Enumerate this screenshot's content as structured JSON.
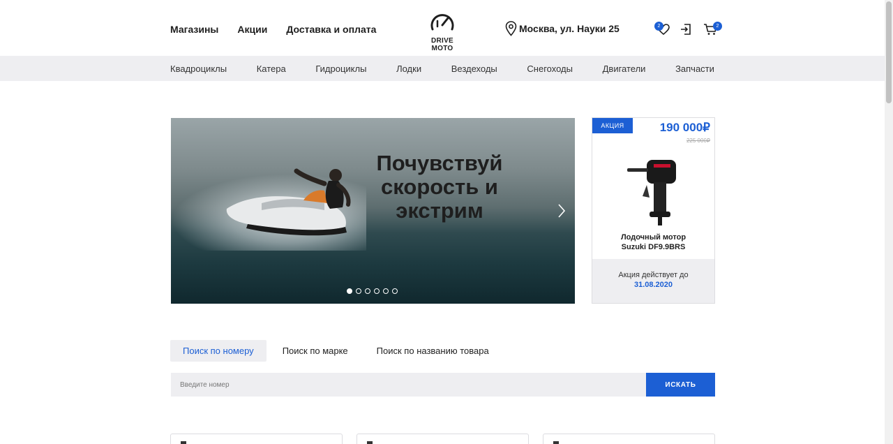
{
  "header": {
    "nav": [
      "Магазины",
      "Акции",
      "Доставка и оплата"
    ],
    "logo_text": "DRIVE MOTO",
    "location": "Москва, ул. Науки 25",
    "favorites_count": "2",
    "cart_count": "2"
  },
  "categories": [
    "Квадроциклы",
    "Катера",
    "Гидроциклы",
    "Лодки",
    "Вездеходы",
    "Снегоходы",
    "Двигатели",
    "Запчасти"
  ],
  "hero": {
    "title_line1": "Почувствуй",
    "title_line2": "скорость и",
    "title_line3": "экстрим",
    "slide_count": 6,
    "active_slide": 1
  },
  "promo": {
    "tag": "АКЦИЯ",
    "price": "190 000₽",
    "old_price": "225 000₽",
    "name_line1": "Лодочный мотор",
    "name_line2": "Suzuki DF9.9BRS",
    "valid_label": "Акция действует до",
    "valid_date": "31.08.2020"
  },
  "search": {
    "tabs": [
      "Поиск по номеру",
      "Поиск по марке",
      "Поиск по названию товара"
    ],
    "active_tab": 0,
    "placeholder": "Введите номер",
    "button_label": "ИСКАТЬ"
  },
  "colors": {
    "accent": "#1c5fd4",
    "panel_bg": "#eeeef1"
  }
}
